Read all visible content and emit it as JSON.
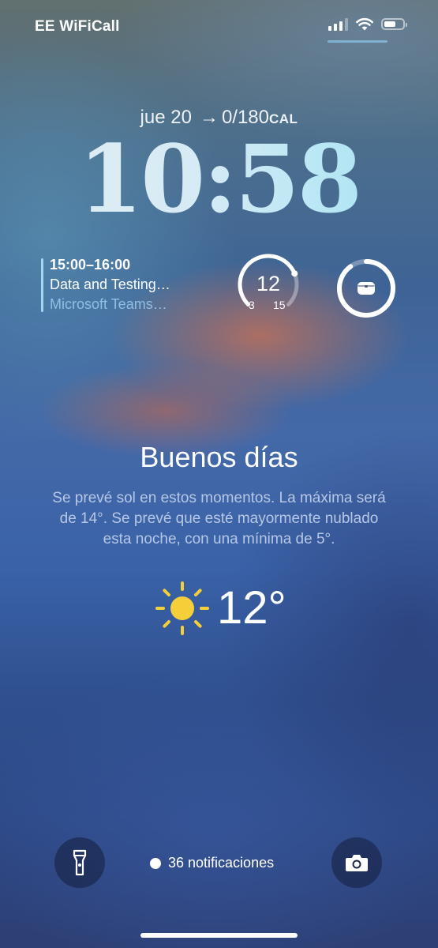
{
  "status_bar": {
    "carrier": "EE WiFiCall",
    "signal_bars_active": 3,
    "signal_bars_total": 4,
    "battery_level": 0.5
  },
  "lock_screen": {
    "date": "jue 20",
    "calories": "0/180",
    "calories_unit": "CAL",
    "time": "10:58"
  },
  "calendar_widget": {
    "time_range": "15:00–16:00",
    "title": "Data and Testing…",
    "subtitle": "Microsoft Teams…"
  },
  "gauge_widget": {
    "value": "12",
    "min": "3",
    "max": "15",
    "fraction": 0.75
  },
  "earbuds_widget": {
    "icon": "earbuds-case-icon",
    "battery_fraction": 0.9
  },
  "weather": {
    "greeting": "Buenos días",
    "forecast": "Se prevé sol en estos momentos. La máxima será de 14°. Se prevé que esté mayormente nublado esta noche, con una mínima de 5°.",
    "icon": "sun-icon",
    "temperature": "12°"
  },
  "bottom": {
    "flashlight_icon": "flashlight-icon",
    "notifications": "36 notificaciones",
    "camera_icon": "camera-icon"
  },
  "colors": {
    "calendar_accent": "#9ed8f2",
    "sun": "#f5cf3a",
    "clock_gradient_end": "#9fe3f4"
  }
}
